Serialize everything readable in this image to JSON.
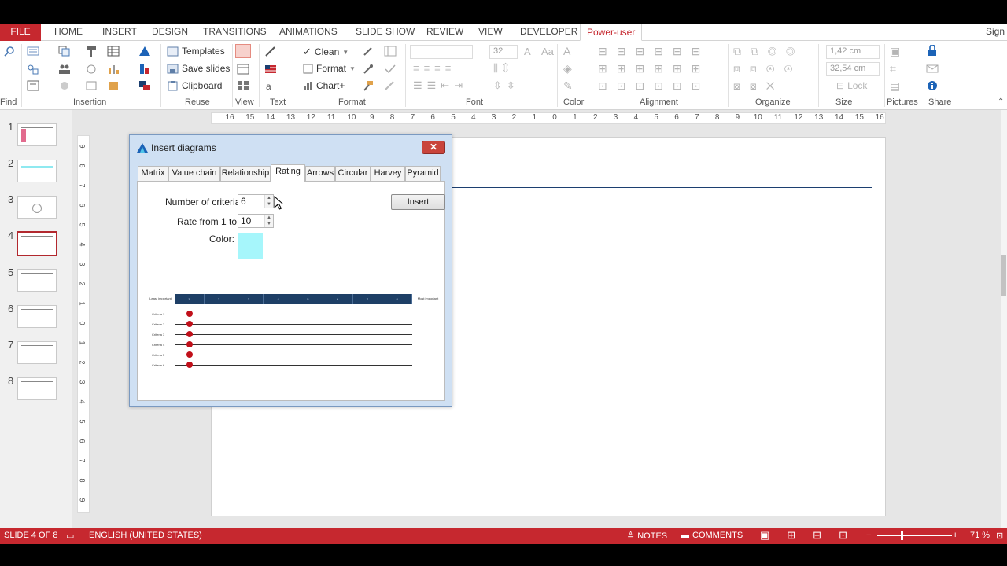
{
  "ribbon_tabs": [
    "FILE",
    "HOME",
    "INSERT",
    "DESIGN",
    "TRANSITIONS",
    "ANIMATIONS",
    "SLIDE SHOW",
    "REVIEW",
    "VIEW",
    "DEVELOPER",
    "Power-user"
  ],
  "sign_in": "Sign",
  "ribbon": {
    "groups": [
      "Find",
      "Insertion",
      "Reuse",
      "View",
      "Text",
      "Format",
      "Font",
      "Color",
      "Alignment",
      "Organize",
      "Size",
      "Pictures",
      "Share"
    ],
    "reuse_buttons": [
      "Templates",
      "Save slides",
      "Clipboard"
    ],
    "format_buttons": [
      "Clean",
      "Format",
      "Chart+"
    ],
    "font_size": "32",
    "width_value": "1,42 cm",
    "height_value": "32,54 cm",
    "lock_label": "Lock"
  },
  "ruler_ticks": [
    "16",
    "15",
    "14",
    "13",
    "12",
    "11",
    "10",
    "9",
    "8",
    "7",
    "6",
    "5",
    "4",
    "3",
    "2",
    "1",
    "0",
    "1",
    "2",
    "3",
    "4",
    "5",
    "6",
    "7",
    "8",
    "9",
    "10",
    "11",
    "12",
    "13",
    "14",
    "15",
    "16"
  ],
  "vruler_ticks": [
    "9",
    "8",
    "7",
    "6",
    "5",
    "4",
    "3",
    "2",
    "1",
    "0",
    "1",
    "2",
    "3",
    "4",
    "5",
    "6",
    "7",
    "8",
    "9"
  ],
  "slides": [
    "1",
    "2",
    "3",
    "4",
    "5",
    "6",
    "7",
    "8"
  ],
  "selected_slide": "4",
  "dialog": {
    "title": "Insert diagrams",
    "close": "✕",
    "tabs": [
      "Matrix",
      "Value chain",
      "Relationship",
      "Rating",
      "Arrows",
      "Circular",
      "Harvey",
      "Pyramid"
    ],
    "active_tab": "Rating",
    "criteria_label": "Number of criteria:",
    "criteria_value": "6",
    "rate_label": "Rate from 1 to",
    "rate_value": "10",
    "color_label": "Color:",
    "color_value": "#a6f6fb",
    "insert_label": "Insert",
    "preview": {
      "left_header": "Least important",
      "right_header": "Most important",
      "scale": [
        "1",
        "2",
        "3",
        "4",
        "5",
        "6",
        "7",
        "8"
      ],
      "criteria": [
        "Criteria 1",
        "Criteria 2",
        "Criteria 3",
        "Criteria 4",
        "Criteria 5",
        "Criteria 6"
      ]
    }
  },
  "status": {
    "slide_info": "SLIDE 4 OF 8",
    "language": "ENGLISH (UNITED STATES)",
    "notes": "NOTES",
    "comments": "COMMENTS",
    "zoom": "71 %"
  },
  "colors": {
    "accent": "#c6282f",
    "dialog_bg": "#cfe0f3",
    "scale_bar": "#1e3f66",
    "dot": "#c0101a"
  }
}
